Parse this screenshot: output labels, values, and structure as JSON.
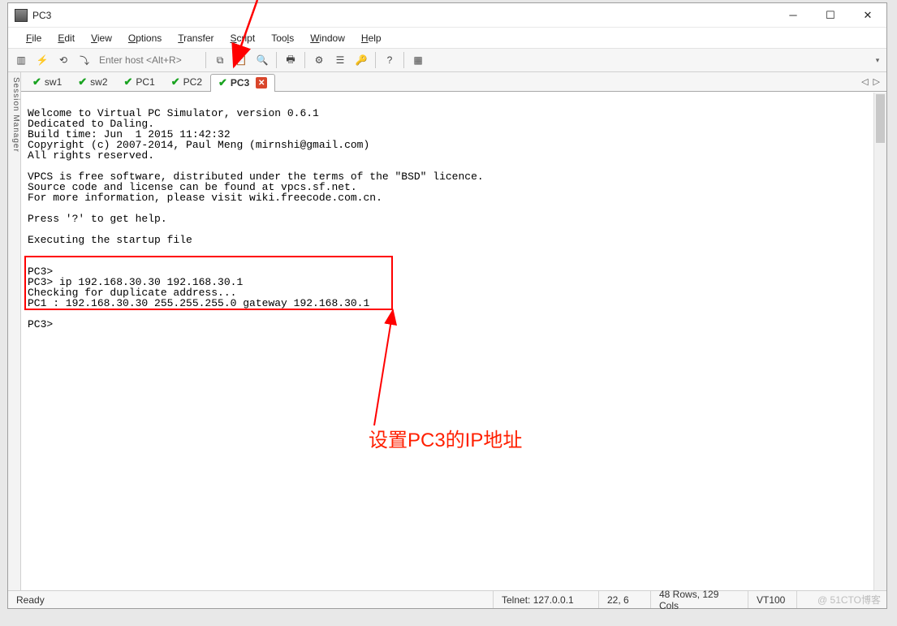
{
  "title": "PC3",
  "menu": [
    "File",
    "Edit",
    "View",
    "Options",
    "Transfer",
    "Script",
    "Tools",
    "Window",
    "Help"
  ],
  "host_placeholder": "Enter host <Alt+R>",
  "side_tab": "Session Manager",
  "tabs": [
    {
      "label": "sw1",
      "active": false
    },
    {
      "label": "sw2",
      "active": false
    },
    {
      "label": "PC1",
      "active": false
    },
    {
      "label": "PC2",
      "active": false
    },
    {
      "label": "PC3",
      "active": true
    }
  ],
  "terminal_lines": [
    "",
    "Welcome to Virtual PC Simulator, version 0.6.1",
    "Dedicated to Daling.",
    "Build time: Jun  1 2015 11:42:32",
    "Copyright (c) 2007-2014, Paul Meng (mirnshi@gmail.com)",
    "All rights reserved.",
    "",
    "VPCS is free software, distributed under the terms of the \"BSD\" licence.",
    "Source code and license can be found at vpcs.sf.net.",
    "For more information, please visit wiki.freecode.com.cn.",
    "",
    "Press '?' to get help.",
    "",
    "Executing the startup file",
    "",
    "",
    "PC3>",
    "PC3> ip 192.168.30.30 192.168.30.1",
    "Checking for duplicate address...",
    "PC1 : 192.168.30.30 255.255.255.0 gateway 192.168.30.1",
    "",
    "PC3>"
  ],
  "annotation": "设置PC3的IP地址",
  "status": {
    "ready": "Ready",
    "conn": "Telnet: 127.0.0.1",
    "pos": "22,   6",
    "size": "48 Rows, 129 Cols",
    "term": "VT100"
  },
  "watermark": "@ 51CTO博客"
}
